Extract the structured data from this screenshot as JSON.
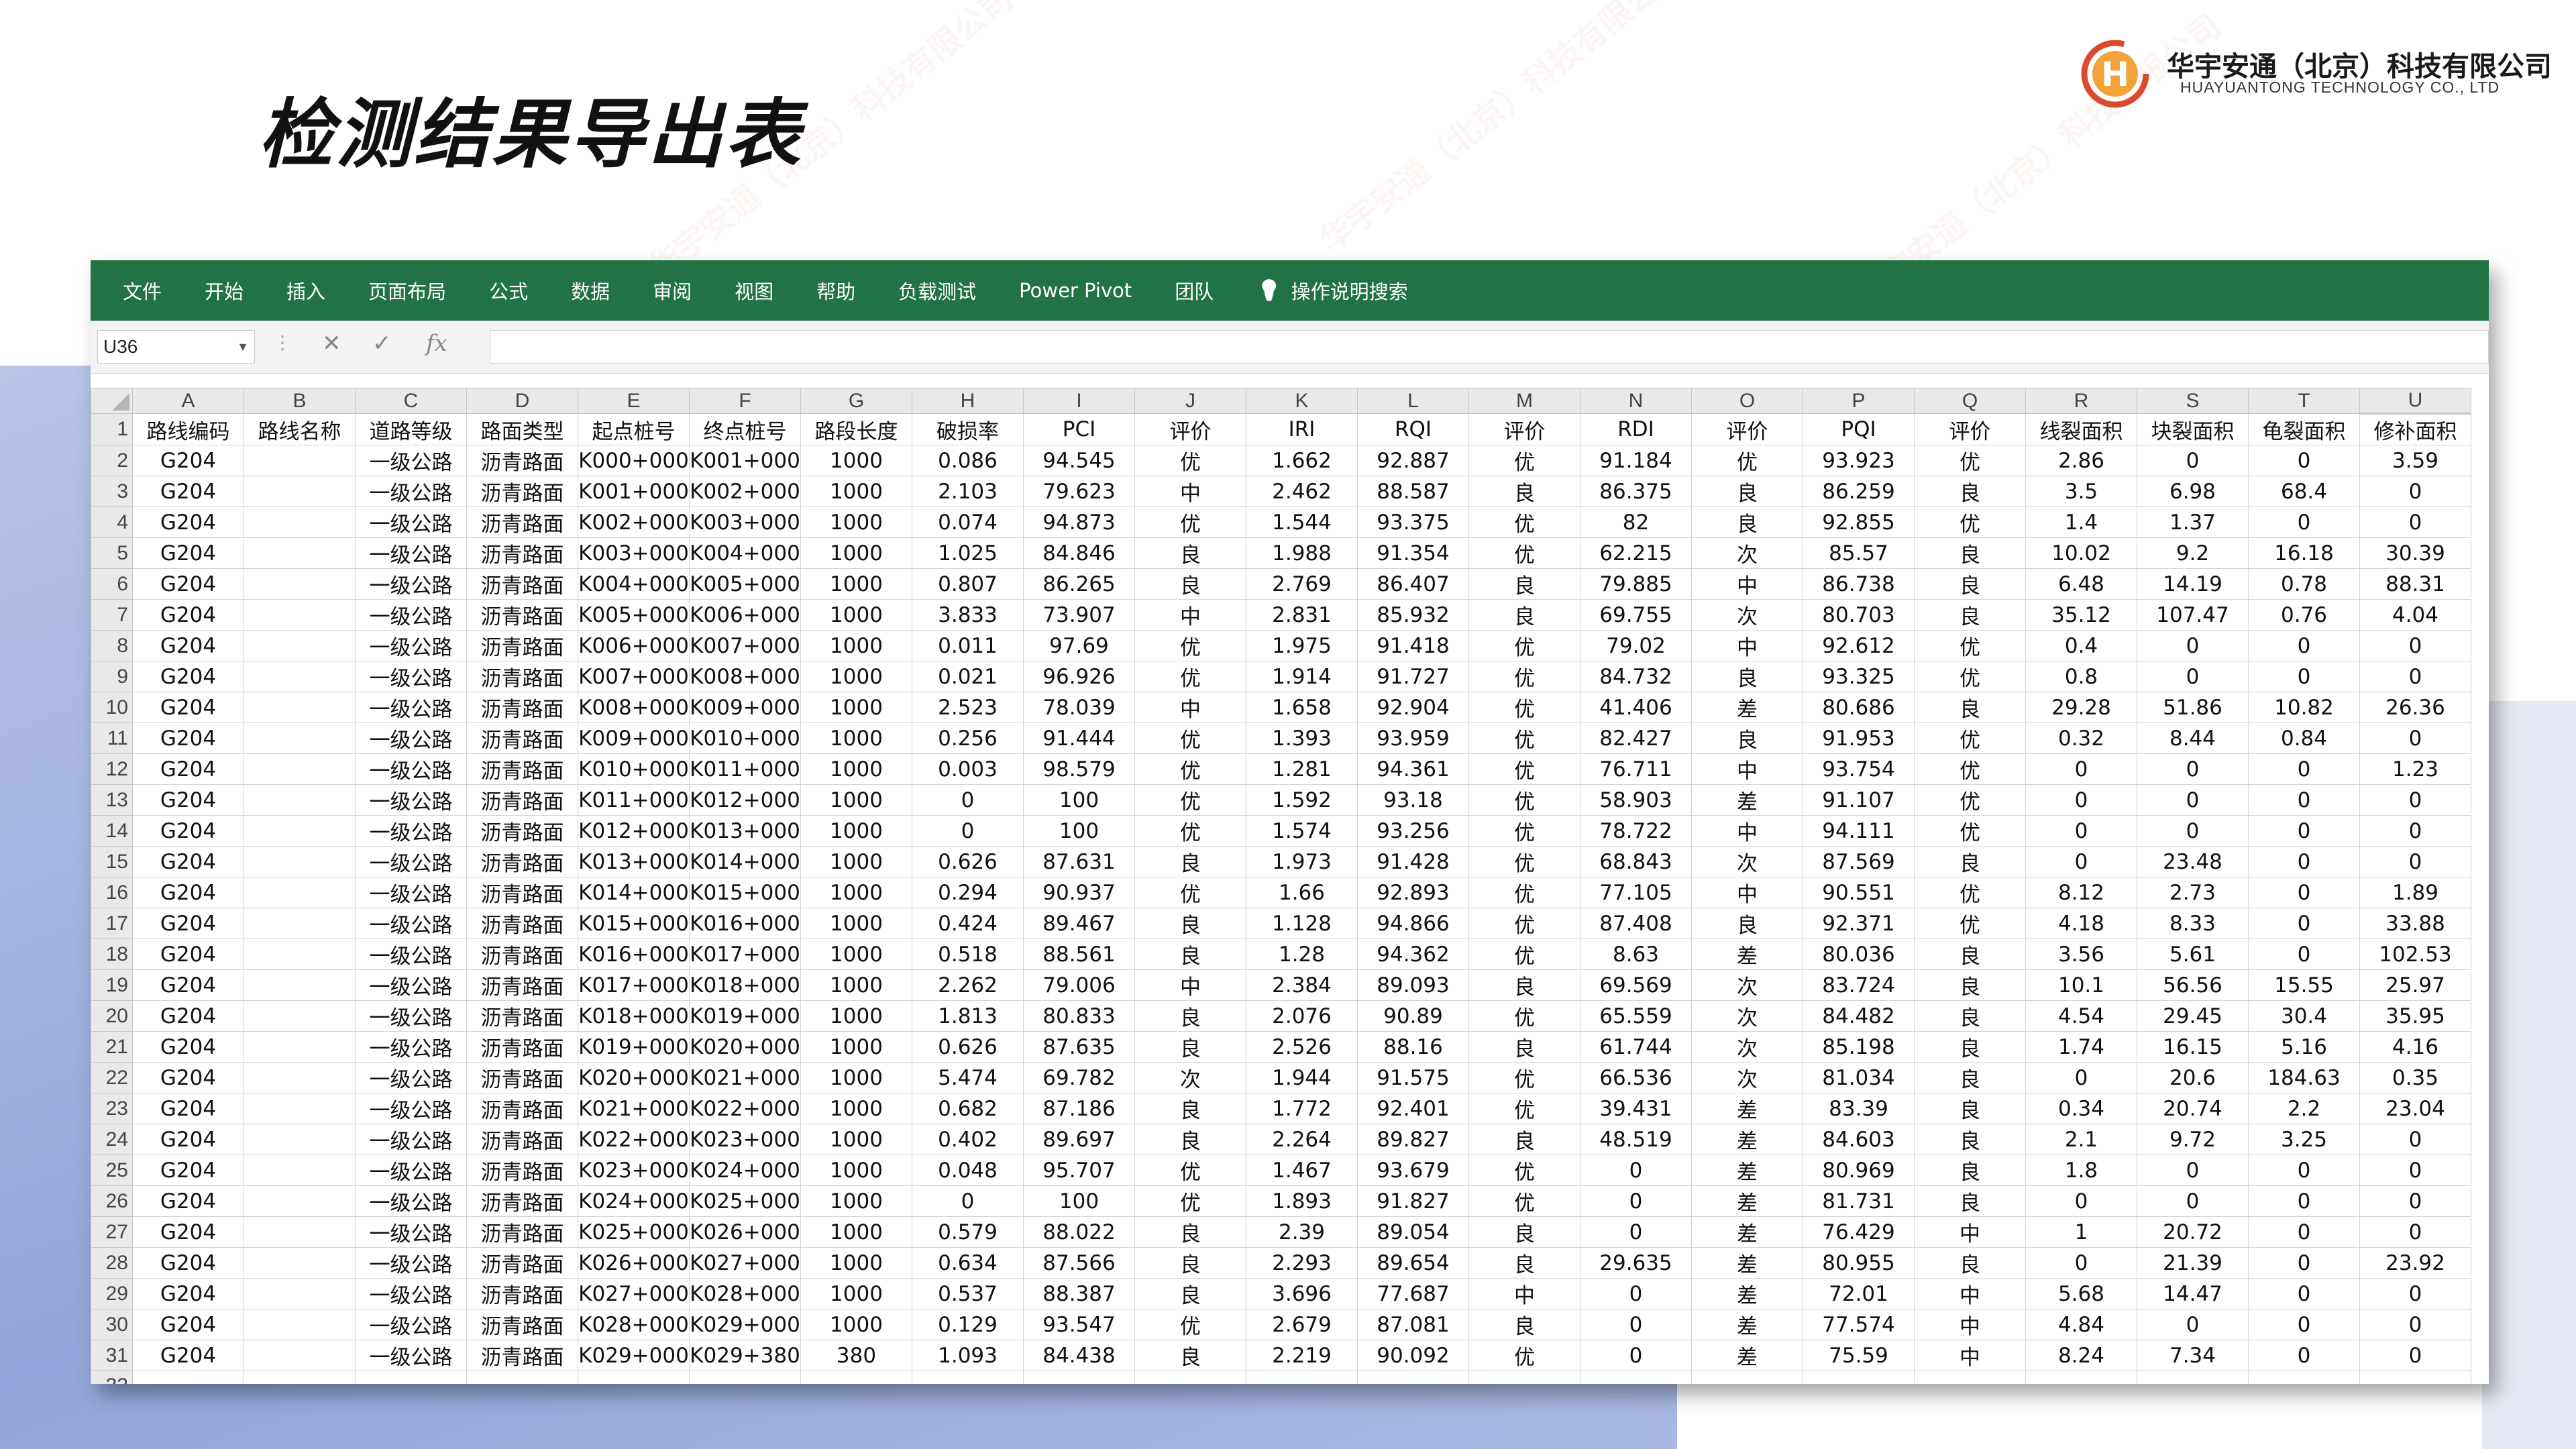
{
  "slide": {
    "title": "检测结果导出表",
    "logo_cn": "华宇安通（北京）科技有限公司",
    "logo_en": "HUAYUANTONG TECHNOLOGY CO., LTD",
    "logo_letter": "H"
  },
  "excel": {
    "tabs": [
      "文件",
      "开始",
      "插入",
      "页面布局",
      "公式",
      "数据",
      "审阅",
      "视图",
      "帮助",
      "负载测试",
      "Power Pivot",
      "团队"
    ],
    "search_label": "操作说明搜索",
    "name_box": "U36",
    "formula_value": "",
    "selected_column": "U",
    "columns": [
      "A",
      "B",
      "C",
      "D",
      "E",
      "F",
      "G",
      "H",
      "I",
      "J",
      "K",
      "L",
      "M",
      "N",
      "O",
      "P",
      "Q",
      "R",
      "S",
      "T",
      "U"
    ],
    "headers": [
      "路线编码",
      "路线名称",
      "道路等级",
      "路面类型",
      "起点桩号",
      "终点桩号",
      "路段长度",
      "破损率",
      "PCI",
      "评价",
      "IRI",
      "RQI",
      "评价",
      "RDI",
      "评价",
      "PQI",
      "评价",
      "线裂面积",
      "块裂面积",
      "龟裂面积",
      "修补面积"
    ],
    "rows": [
      [
        "G204",
        "",
        "一级公路",
        "沥青路面",
        "K000+000",
        "K001+000",
        "1000",
        "0.086",
        "94.545",
        "优",
        "1.662",
        "92.887",
        "优",
        "91.184",
        "优",
        "93.923",
        "优",
        "2.86",
        "0",
        "0",
        "3.59"
      ],
      [
        "G204",
        "",
        "一级公路",
        "沥青路面",
        "K001+000",
        "K002+000",
        "1000",
        "2.103",
        "79.623",
        "中",
        "2.462",
        "88.587",
        "良",
        "86.375",
        "良",
        "86.259",
        "良",
        "3.5",
        "6.98",
        "68.4",
        "0"
      ],
      [
        "G204",
        "",
        "一级公路",
        "沥青路面",
        "K002+000",
        "K003+000",
        "1000",
        "0.074",
        "94.873",
        "优",
        "1.544",
        "93.375",
        "优",
        "82",
        "良",
        "92.855",
        "优",
        "1.4",
        "1.37",
        "0",
        "0"
      ],
      [
        "G204",
        "",
        "一级公路",
        "沥青路面",
        "K003+000",
        "K004+000",
        "1000",
        "1.025",
        "84.846",
        "良",
        "1.988",
        "91.354",
        "优",
        "62.215",
        "次",
        "85.57",
        "良",
        "10.02",
        "9.2",
        "16.18",
        "30.39"
      ],
      [
        "G204",
        "",
        "一级公路",
        "沥青路面",
        "K004+000",
        "K005+000",
        "1000",
        "0.807",
        "86.265",
        "良",
        "2.769",
        "86.407",
        "良",
        "79.885",
        "中",
        "86.738",
        "良",
        "6.48",
        "14.19",
        "0.78",
        "88.31"
      ],
      [
        "G204",
        "",
        "一级公路",
        "沥青路面",
        "K005+000",
        "K006+000",
        "1000",
        "3.833",
        "73.907",
        "中",
        "2.831",
        "85.932",
        "良",
        "69.755",
        "次",
        "80.703",
        "良",
        "35.12",
        "107.47",
        "0.76",
        "4.04"
      ],
      [
        "G204",
        "",
        "一级公路",
        "沥青路面",
        "K006+000",
        "K007+000",
        "1000",
        "0.011",
        "97.69",
        "优",
        "1.975",
        "91.418",
        "优",
        "79.02",
        "中",
        "92.612",
        "优",
        "0.4",
        "0",
        "0",
        "0"
      ],
      [
        "G204",
        "",
        "一级公路",
        "沥青路面",
        "K007+000",
        "K008+000",
        "1000",
        "0.021",
        "96.926",
        "优",
        "1.914",
        "91.727",
        "优",
        "84.732",
        "良",
        "93.325",
        "优",
        "0.8",
        "0",
        "0",
        "0"
      ],
      [
        "G204",
        "",
        "一级公路",
        "沥青路面",
        "K008+000",
        "K009+000",
        "1000",
        "2.523",
        "78.039",
        "中",
        "1.658",
        "92.904",
        "优",
        "41.406",
        "差",
        "80.686",
        "良",
        "29.28",
        "51.86",
        "10.82",
        "26.36"
      ],
      [
        "G204",
        "",
        "一级公路",
        "沥青路面",
        "K009+000",
        "K010+000",
        "1000",
        "0.256",
        "91.444",
        "优",
        "1.393",
        "93.959",
        "优",
        "82.427",
        "良",
        "91.953",
        "优",
        "0.32",
        "8.44",
        "0.84",
        "0"
      ],
      [
        "G204",
        "",
        "一级公路",
        "沥青路面",
        "K010+000",
        "K011+000",
        "1000",
        "0.003",
        "98.579",
        "优",
        "1.281",
        "94.361",
        "优",
        "76.711",
        "中",
        "93.754",
        "优",
        "0",
        "0",
        "0",
        "1.23"
      ],
      [
        "G204",
        "",
        "一级公路",
        "沥青路面",
        "K011+000",
        "K012+000",
        "1000",
        "0",
        "100",
        "优",
        "1.592",
        "93.18",
        "优",
        "58.903",
        "差",
        "91.107",
        "优",
        "0",
        "0",
        "0",
        "0"
      ],
      [
        "G204",
        "",
        "一级公路",
        "沥青路面",
        "K012+000",
        "K013+000",
        "1000",
        "0",
        "100",
        "优",
        "1.574",
        "93.256",
        "优",
        "78.722",
        "中",
        "94.111",
        "优",
        "0",
        "0",
        "0",
        "0"
      ],
      [
        "G204",
        "",
        "一级公路",
        "沥青路面",
        "K013+000",
        "K014+000",
        "1000",
        "0.626",
        "87.631",
        "良",
        "1.973",
        "91.428",
        "优",
        "68.843",
        "次",
        "87.569",
        "良",
        "0",
        "23.48",
        "0",
        "0"
      ],
      [
        "G204",
        "",
        "一级公路",
        "沥青路面",
        "K014+000",
        "K015+000",
        "1000",
        "0.294",
        "90.937",
        "优",
        "1.66",
        "92.893",
        "优",
        "77.105",
        "中",
        "90.551",
        "优",
        "8.12",
        "2.73",
        "0",
        "1.89"
      ],
      [
        "G204",
        "",
        "一级公路",
        "沥青路面",
        "K015+000",
        "K016+000",
        "1000",
        "0.424",
        "89.467",
        "良",
        "1.128",
        "94.866",
        "优",
        "87.408",
        "良",
        "92.371",
        "优",
        "4.18",
        "8.33",
        "0",
        "33.88"
      ],
      [
        "G204",
        "",
        "一级公路",
        "沥青路面",
        "K016+000",
        "K017+000",
        "1000",
        "0.518",
        "88.561",
        "良",
        "1.28",
        "94.362",
        "优",
        "8.63",
        "差",
        "80.036",
        "良",
        "3.56",
        "5.61",
        "0",
        "102.53"
      ],
      [
        "G204",
        "",
        "一级公路",
        "沥青路面",
        "K017+000",
        "K018+000",
        "1000",
        "2.262",
        "79.006",
        "中",
        "2.384",
        "89.093",
        "良",
        "69.569",
        "次",
        "83.724",
        "良",
        "10.1",
        "56.56",
        "15.55",
        "25.97"
      ],
      [
        "G204",
        "",
        "一级公路",
        "沥青路面",
        "K018+000",
        "K019+000",
        "1000",
        "1.813",
        "80.833",
        "良",
        "2.076",
        "90.89",
        "优",
        "65.559",
        "次",
        "84.482",
        "良",
        "4.54",
        "29.45",
        "30.4",
        "35.95"
      ],
      [
        "G204",
        "",
        "一级公路",
        "沥青路面",
        "K019+000",
        "K020+000",
        "1000",
        "0.626",
        "87.635",
        "良",
        "2.526",
        "88.16",
        "良",
        "61.744",
        "次",
        "85.198",
        "良",
        "1.74",
        "16.15",
        "5.16",
        "4.16"
      ],
      [
        "G204",
        "",
        "一级公路",
        "沥青路面",
        "K020+000",
        "K021+000",
        "1000",
        "5.474",
        "69.782",
        "次",
        "1.944",
        "91.575",
        "优",
        "66.536",
        "次",
        "81.034",
        "良",
        "0",
        "20.6",
        "184.63",
        "0.35"
      ],
      [
        "G204",
        "",
        "一级公路",
        "沥青路面",
        "K021+000",
        "K022+000",
        "1000",
        "0.682",
        "87.186",
        "良",
        "1.772",
        "92.401",
        "优",
        "39.431",
        "差",
        "83.39",
        "良",
        "0.34",
        "20.74",
        "2.2",
        "23.04"
      ],
      [
        "G204",
        "",
        "一级公路",
        "沥青路面",
        "K022+000",
        "K023+000",
        "1000",
        "0.402",
        "89.697",
        "良",
        "2.264",
        "89.827",
        "良",
        "48.519",
        "差",
        "84.603",
        "良",
        "2.1",
        "9.72",
        "3.25",
        "0"
      ],
      [
        "G204",
        "",
        "一级公路",
        "沥青路面",
        "K023+000",
        "K024+000",
        "1000",
        "0.048",
        "95.707",
        "优",
        "1.467",
        "93.679",
        "优",
        "0",
        "差",
        "80.969",
        "良",
        "1.8",
        "0",
        "0",
        "0"
      ],
      [
        "G204",
        "",
        "一级公路",
        "沥青路面",
        "K024+000",
        "K025+000",
        "1000",
        "0",
        "100",
        "优",
        "1.893",
        "91.827",
        "优",
        "0",
        "差",
        "81.731",
        "良",
        "0",
        "0",
        "0",
        "0"
      ],
      [
        "G204",
        "",
        "一级公路",
        "沥青路面",
        "K025+000",
        "K026+000",
        "1000",
        "0.579",
        "88.022",
        "良",
        "2.39",
        "89.054",
        "良",
        "0",
        "差",
        "76.429",
        "中",
        "1",
        "20.72",
        "0",
        "0"
      ],
      [
        "G204",
        "",
        "一级公路",
        "沥青路面",
        "K026+000",
        "K027+000",
        "1000",
        "0.634",
        "87.566",
        "良",
        "2.293",
        "89.654",
        "良",
        "29.635",
        "差",
        "80.955",
        "良",
        "0",
        "21.39",
        "0",
        "23.92"
      ],
      [
        "G204",
        "",
        "一级公路",
        "沥青路面",
        "K027+000",
        "K028+000",
        "1000",
        "0.537",
        "88.387",
        "良",
        "3.696",
        "77.687",
        "中",
        "0",
        "差",
        "72.01",
        "中",
        "5.68",
        "14.47",
        "0",
        "0"
      ],
      [
        "G204",
        "",
        "一级公路",
        "沥青路面",
        "K028+000",
        "K029+000",
        "1000",
        "0.129",
        "93.547",
        "优",
        "2.679",
        "87.081",
        "良",
        "0",
        "差",
        "77.574",
        "中",
        "4.84",
        "0",
        "0",
        "0"
      ],
      [
        "G204",
        "",
        "一级公路",
        "沥青路面",
        "K029+000",
        "K029+380",
        "380",
        "1.093",
        "84.438",
        "良",
        "2.219",
        "90.092",
        "优",
        "0",
        "差",
        "75.59",
        "中",
        "8.24",
        "7.34",
        "0",
        "0"
      ],
      [
        "",
        "",
        "",
        "",
        "",
        "",
        "",
        "",
        "",
        "",
        "",
        "",
        "",
        "",
        "",
        "",
        "",
        "",
        "",
        "",
        ""
      ]
    ],
    "colors": {
      "ribbon": "#217346",
      "header_bg": "#e9e9e9",
      "grid": "#d4d4d4"
    }
  }
}
